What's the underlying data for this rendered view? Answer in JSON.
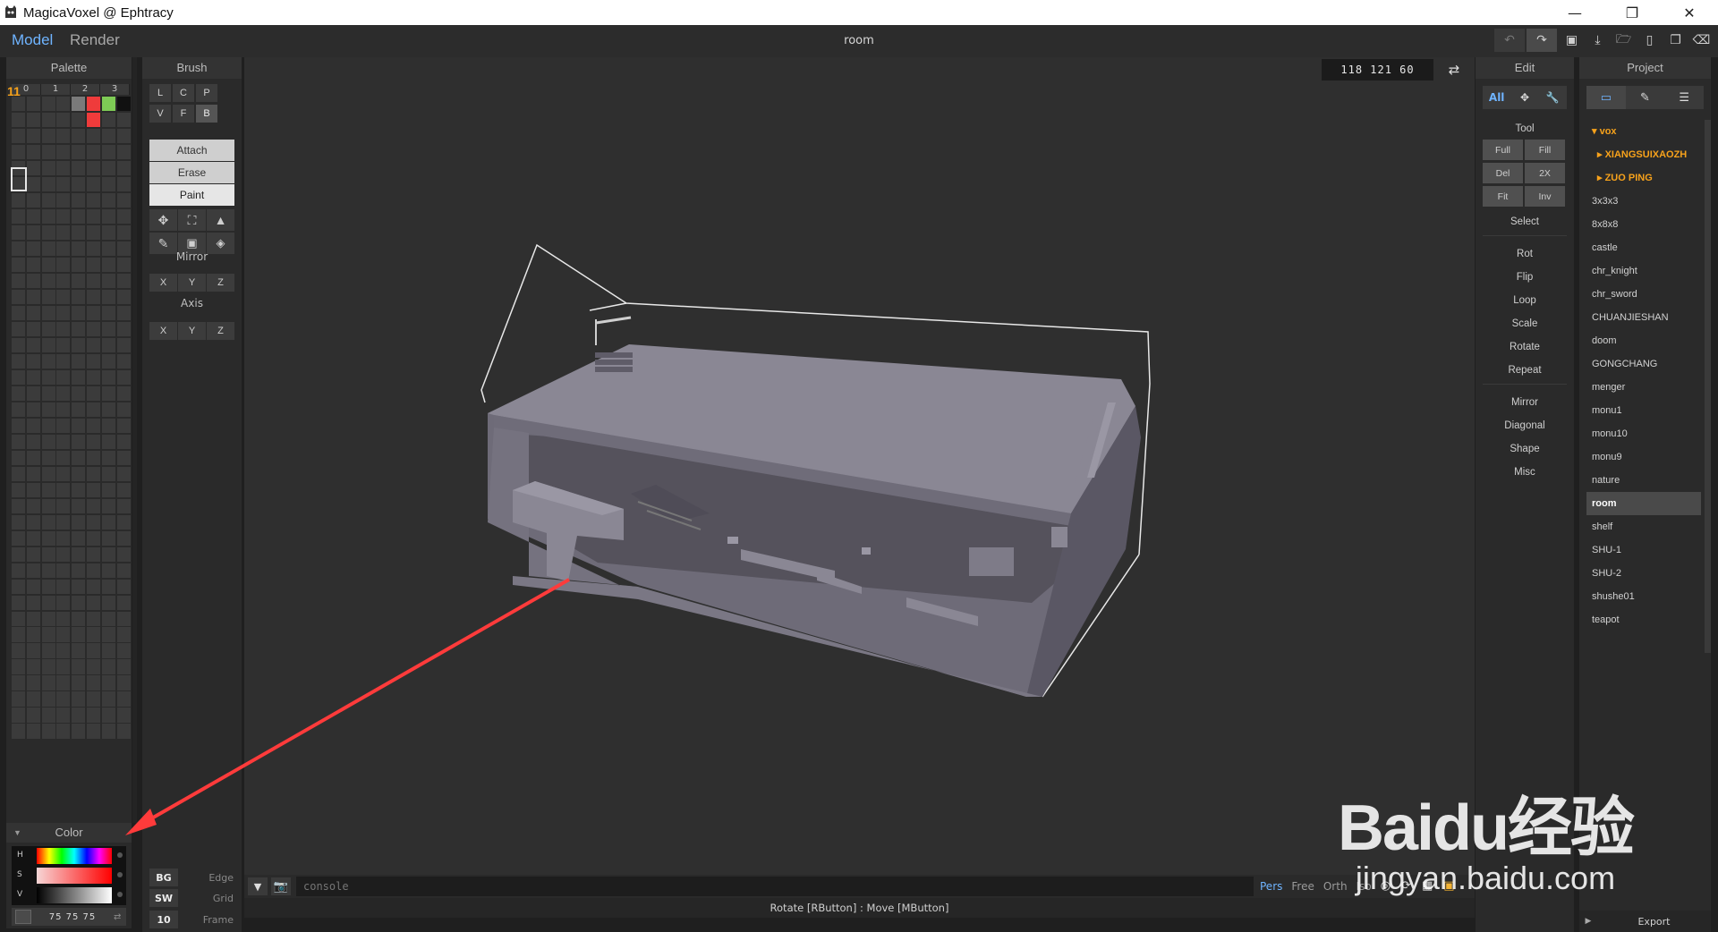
{
  "window": {
    "title": "MagicaVoxel @ Ephtracy",
    "controls": [
      "minimize-icon",
      "restore-icon",
      "close-icon"
    ]
  },
  "menubar": {
    "mode_model": "Model",
    "mode_render": "Render",
    "filename": "room",
    "tools": [
      "undo-icon",
      "redo-icon",
      "save-icon",
      "save-as-icon",
      "open-icon",
      "new-icon",
      "copy-icon",
      "delete-icon"
    ]
  },
  "palette": {
    "header": "Palette",
    "columns": [
      "0",
      "1",
      "2",
      "3"
    ],
    "index_label": "11",
    "colors": {
      "row0": [
        "#3b3b3b",
        "#3b3b3b",
        "#3b3b3b",
        "#3b3b3b",
        "#7a7a7a",
        "#ef3b3b",
        "#7ecb55",
        "#111111"
      ],
      "row1": [
        "#3b3b3b",
        "#3b3b3b",
        "#3b3b3b",
        "#3b3b3b",
        "#3b3b3b",
        "#ef3b3b",
        "#3b3b3b",
        "#3b3b3b"
      ]
    }
  },
  "color": {
    "header": "Color",
    "labels": [
      "H",
      "S",
      "V"
    ],
    "value": "75  75  75"
  },
  "brush": {
    "header": "Brush",
    "row1": [
      "L",
      "C",
      "P"
    ],
    "row2": [
      "V",
      "F",
      "B"
    ],
    "modes": [
      "Attach",
      "Erase",
      "Paint"
    ],
    "mirror_label": "Mirror",
    "mirror": [
      "X",
      "Y",
      "Z"
    ],
    "axis_label": "Axis",
    "axis": [
      "X",
      "Y",
      "Z"
    ]
  },
  "settings": {
    "bg": "BG",
    "edge": "Edge",
    "sw": "SW",
    "grid": "Grid",
    "frame_value": "10",
    "frame": "Frame"
  },
  "viewport": {
    "coords": "118  121  60",
    "console_placeholder": "console",
    "view_modes": [
      "Pers",
      "Free",
      "Orth",
      "Iso"
    ],
    "status": "Rotate [RButton] : Move [MButton]"
  },
  "edit": {
    "header": "Edit",
    "tabs": [
      "All"
    ],
    "tool_label": "Tool",
    "tool_buttons": [
      "Full",
      "Fill",
      "Del",
      "2X",
      "Fit",
      "Inv"
    ],
    "select": "Select",
    "actions": [
      "Rot",
      "Flip",
      "Loop",
      "Scale",
      "Rotate",
      "Repeat"
    ],
    "actions2": [
      "Mirror",
      "Diagonal",
      "Shape",
      "Misc"
    ]
  },
  "project": {
    "header": "Project",
    "folder": "vox",
    "subfolders": [
      "XIANGSUIXAOZH",
      "ZUO PING"
    ],
    "files": [
      "3x3x3",
      "8x8x8",
      "castle",
      "chr_knight",
      "chr_sword",
      "CHUANJIESHAN",
      "doom",
      "GONGCHANG",
      "menger",
      "monu1",
      "monu10",
      "monu9",
      "nature",
      "room",
      "shelf",
      "SHU-1",
      "SHU-2",
      "shushe01",
      "teapot"
    ],
    "selected": "room",
    "export": "Export"
  },
  "watermark": {
    "logo": "Baidu经验",
    "url": "jingyan.baidu.com"
  }
}
